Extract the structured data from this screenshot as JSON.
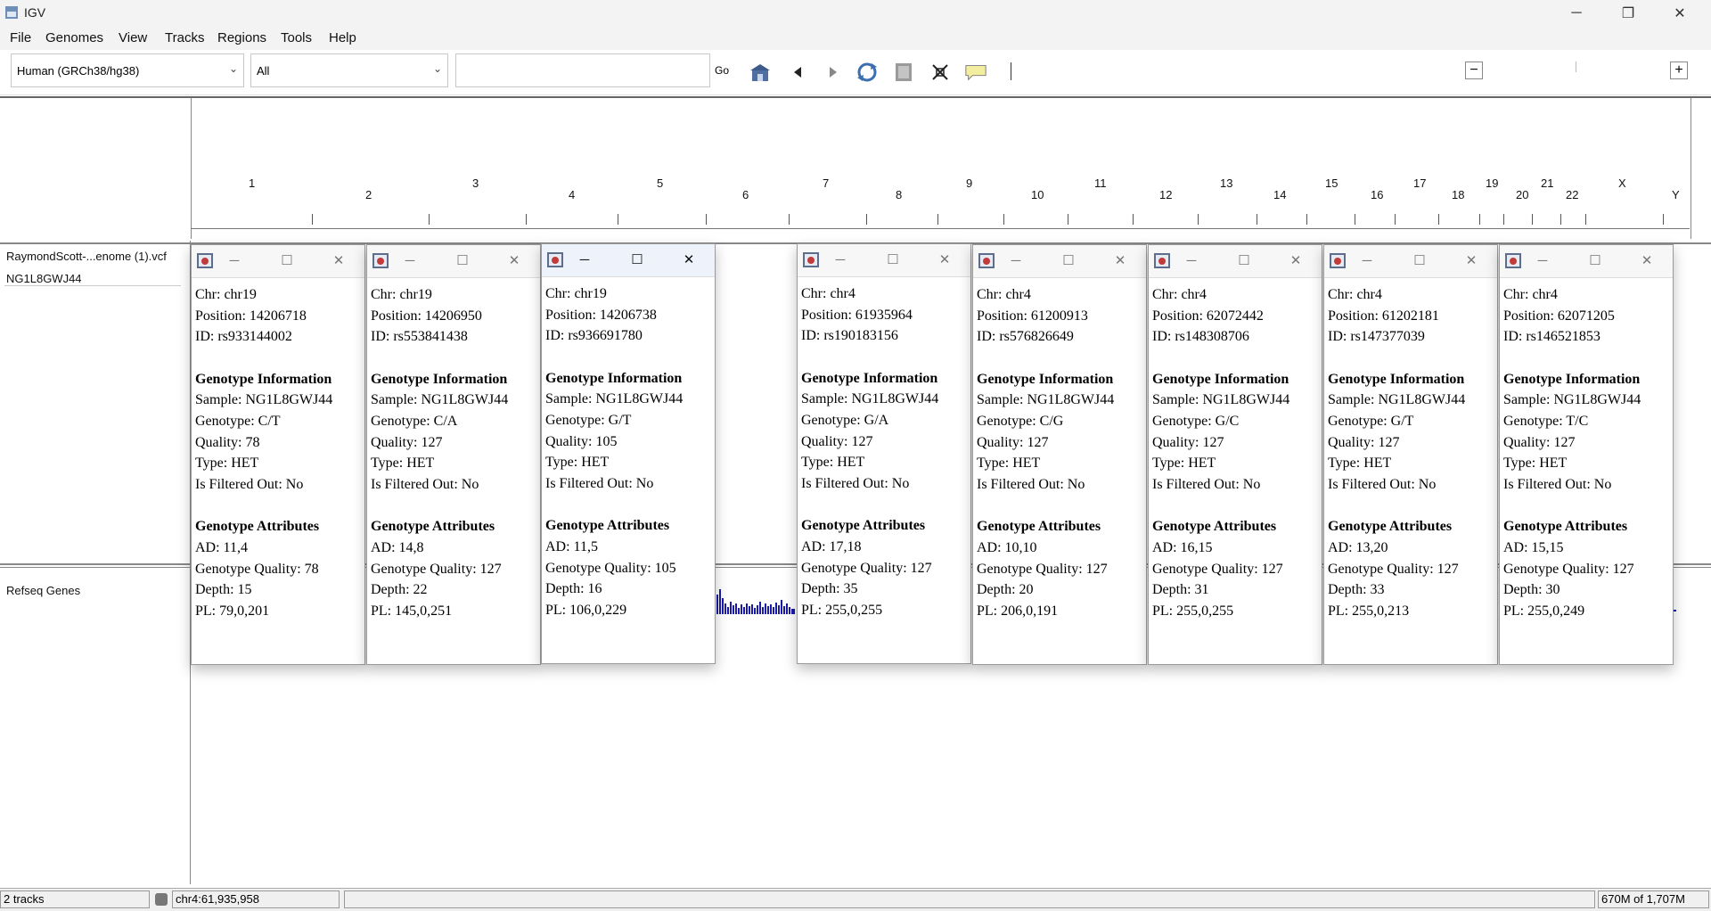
{
  "window": {
    "title": "IGV",
    "minimize": "─",
    "maximize": "❐",
    "close": "✕"
  },
  "menu": [
    "File",
    "Genomes",
    "View",
    "Tracks",
    "Regions",
    "Tools",
    "Help"
  ],
  "toolbar": {
    "genome": "Human (GRCh38/hg38)",
    "chromosome": "All",
    "locus_value": "",
    "go_label": "Go",
    "icons": [
      "home-icon",
      "back-icon",
      "forward-icon",
      "refresh-icon",
      "resize-icon",
      "roi-icon",
      "popup-text-icon"
    ],
    "zoom_minus": "−",
    "zoom_plus": "+"
  },
  "chromosomes": [
    "1",
    "2",
    "3",
    "4",
    "5",
    "6",
    "7",
    "8",
    "9",
    "10",
    "11",
    "12",
    "13",
    "14",
    "15",
    "16",
    "17",
    "18",
    "19",
    "20",
    "21",
    "22",
    "X",
    "Y"
  ],
  "tracks": {
    "vcf_name": "RaymondScott-...enome (1).vcf",
    "sample_name": "NG1L8GWJ44",
    "gene_track": "Refseq Genes"
  },
  "status": {
    "tracks": "2 tracks",
    "locus": "chr4:61,935,958",
    "message": "",
    "memory": "670M of 1,707M"
  },
  "popups": [
    {
      "chr": "Chr: chr19",
      "position": "Position: 14206718",
      "id": "ID: rs933144002",
      "h1": "Genotype Information",
      "sample": "Sample: NG1L8GWJ44",
      "genotype": "Genotype: C/T",
      "quality": "Quality: 78",
      "type": "Type: HET",
      "filtered": "Is Filtered Out: No",
      "h2": "Genotype Attributes",
      "ad": "AD: 11,4",
      "gq": "Genotype Quality: 78",
      "depth": "Depth: 15",
      "pl": "PL: 79,0,201"
    },
    {
      "chr": "Chr: chr19",
      "position": "Position: 14206950",
      "id": "ID: rs553841438",
      "h1": "Genotype Information",
      "sample": "Sample: NG1L8GWJ44",
      "genotype": "Genotype: C/A",
      "quality": "Quality: 127",
      "type": "Type: HET",
      "filtered": "Is Filtered Out: No",
      "h2": "Genotype Attributes",
      "ad": "AD: 14,8",
      "gq": "Genotype Quality: 127",
      "depth": "Depth: 22",
      "pl": "PL: 145,0,251"
    },
    {
      "chr": "Chr: chr19",
      "position": "Position: 14206738",
      "id": "ID: rs936691780",
      "h1": "Genotype Information",
      "sample": "Sample: NG1L8GWJ44",
      "genotype": "Genotype: G/T",
      "quality": "Quality: 105",
      "type": "Type: HET",
      "filtered": "Is Filtered Out: No",
      "h2": "Genotype Attributes",
      "ad": "AD: 11,5",
      "gq": "Genotype Quality: 105",
      "depth": "Depth: 16",
      "pl": "PL: 106,0,229"
    },
    {
      "chr": "Chr: chr4",
      "position": "Position: 61935964",
      "id": "ID: rs190183156",
      "h1": "Genotype Information",
      "sample": "Sample: NG1L8GWJ44",
      "genotype": "Genotype: G/A",
      "quality": "Quality: 127",
      "type": "Type: HET",
      "filtered": "Is Filtered Out: No",
      "h2": "Genotype Attributes",
      "ad": "AD: 17,18",
      "gq": "Genotype Quality: 127",
      "depth": "Depth: 35",
      "pl": "PL: 255,0,255"
    },
    {
      "chr": "Chr: chr4",
      "position": "Position: 61200913",
      "id": "ID: rs576826649",
      "h1": "Genotype Information",
      "sample": "Sample: NG1L8GWJ44",
      "genotype": "Genotype: C/G",
      "quality": "Quality: 127",
      "type": "Type: HET",
      "filtered": "Is Filtered Out: No",
      "h2": "Genotype Attributes",
      "ad": "AD: 10,10",
      "gq": "Genotype Quality: 127",
      "depth": "Depth: 20",
      "pl": "PL: 206,0,191"
    },
    {
      "chr": "Chr: chr4",
      "position": "Position: 62072442",
      "id": "ID: rs148308706",
      "h1": "Genotype Information",
      "sample": "Sample: NG1L8GWJ44",
      "genotype": "Genotype: G/C",
      "quality": "Quality: 127",
      "type": "Type: HET",
      "filtered": "Is Filtered Out: No",
      "h2": "Genotype Attributes",
      "ad": "AD: 16,15",
      "gq": "Genotype Quality: 127",
      "depth": "Depth: 31",
      "pl": "PL: 255,0,255"
    },
    {
      "chr": "Chr: chr4",
      "position": "Position: 61202181",
      "id": "ID: rs147377039",
      "h1": "Genotype Information",
      "sample": "Sample: NG1L8GWJ44",
      "genotype": "Genotype: G/T",
      "quality": "Quality: 127",
      "type": "Type: HET",
      "filtered": "Is Filtered Out: No",
      "h2": "Genotype Attributes",
      "ad": "AD: 13,20",
      "gq": "Genotype Quality: 127",
      "depth": "Depth: 33",
      "pl": "PL: 255,0,213"
    },
    {
      "chr": "Chr: chr4",
      "position": "Position: 62071205",
      "id": "ID: rs146521853",
      "h1": "Genotype Information",
      "sample": "Sample: NG1L8GWJ44",
      "genotype": "Genotype: T/C",
      "quality": "Quality: 127",
      "type": "Type: HET",
      "filtered": "Is Filtered Out: No",
      "h2": "Genotype Attributes",
      "ad": "AD: 15,15",
      "gq": "Genotype Quality: 127",
      "depth": "Depth: 30",
      "pl": "PL: 255,0,249"
    }
  ],
  "colors": {
    "gene_density": "#1a1aa6",
    "title_bg": "#f3f3f3",
    "active_popup_title": "#eef2fb"
  }
}
